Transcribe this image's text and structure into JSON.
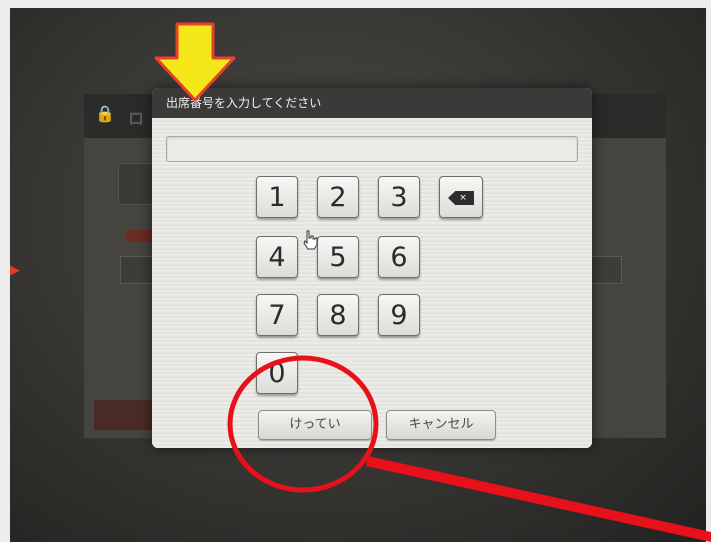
{
  "background_app": {
    "title_fragment": "ロ"
  },
  "dialog": {
    "title": "出席番号を入力してください",
    "number_value": "",
    "keys": [
      "1",
      "2",
      "3",
      "4",
      "5",
      "6",
      "7",
      "8",
      "9",
      "0"
    ],
    "backspace_glyph": "×",
    "confirm_label": "けってい",
    "cancel_label": "キャンセル"
  },
  "icons": {
    "backspace": "backspace-icon",
    "cursor": "hand-pointer-icon",
    "lock": "lock-icon"
  },
  "annotations": {
    "arrow_color": "#f5e81a",
    "arrow_outline": "#e8412b",
    "circle_color": "#e8111b"
  }
}
